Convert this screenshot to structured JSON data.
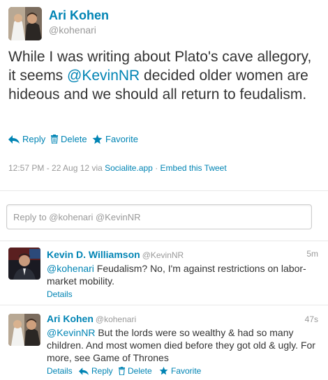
{
  "tweet": {
    "author_name": "Ari Kohen",
    "author_handle": "@kohenari",
    "text_before": "While I was writing about Plato's cave allegory, it seems ",
    "mention": "@KevinNR",
    "text_after": " decided older women are hideous and we should all return to feudalism.",
    "timestamp": "12:57 PM - 22 Aug 12",
    "via_label": "via",
    "via_app": "Socialite.app",
    "separator": "·",
    "embed_label": "Embed this Tweet"
  },
  "actions": {
    "reply": "Reply",
    "delete": "Delete",
    "favorite": "Favorite"
  },
  "reply_box": {
    "placeholder": "Reply to @kohenari @KevinNR"
  },
  "replies": [
    {
      "name": "Kevin D. Williamson",
      "handle": "@KevinNR",
      "time": "5m",
      "mention": "@kohenari",
      "text": " Feudalism? No, I'm against restrictions on labor-market mobility.",
      "details": "Details"
    },
    {
      "name": "Ari Kohen",
      "handle": "@kohenari",
      "time": "47s",
      "mention": "@KevinNR",
      "text": " But the lords were so wealthy & had so many children. And most women died before they got old & ugly. For more, see Game of Thrones",
      "details": "Details",
      "reply": "Reply",
      "delete": "Delete",
      "favorite": "Favorite"
    }
  ],
  "colors": {
    "link": "#0084b4",
    "muted": "#999999",
    "text": "#333333"
  }
}
